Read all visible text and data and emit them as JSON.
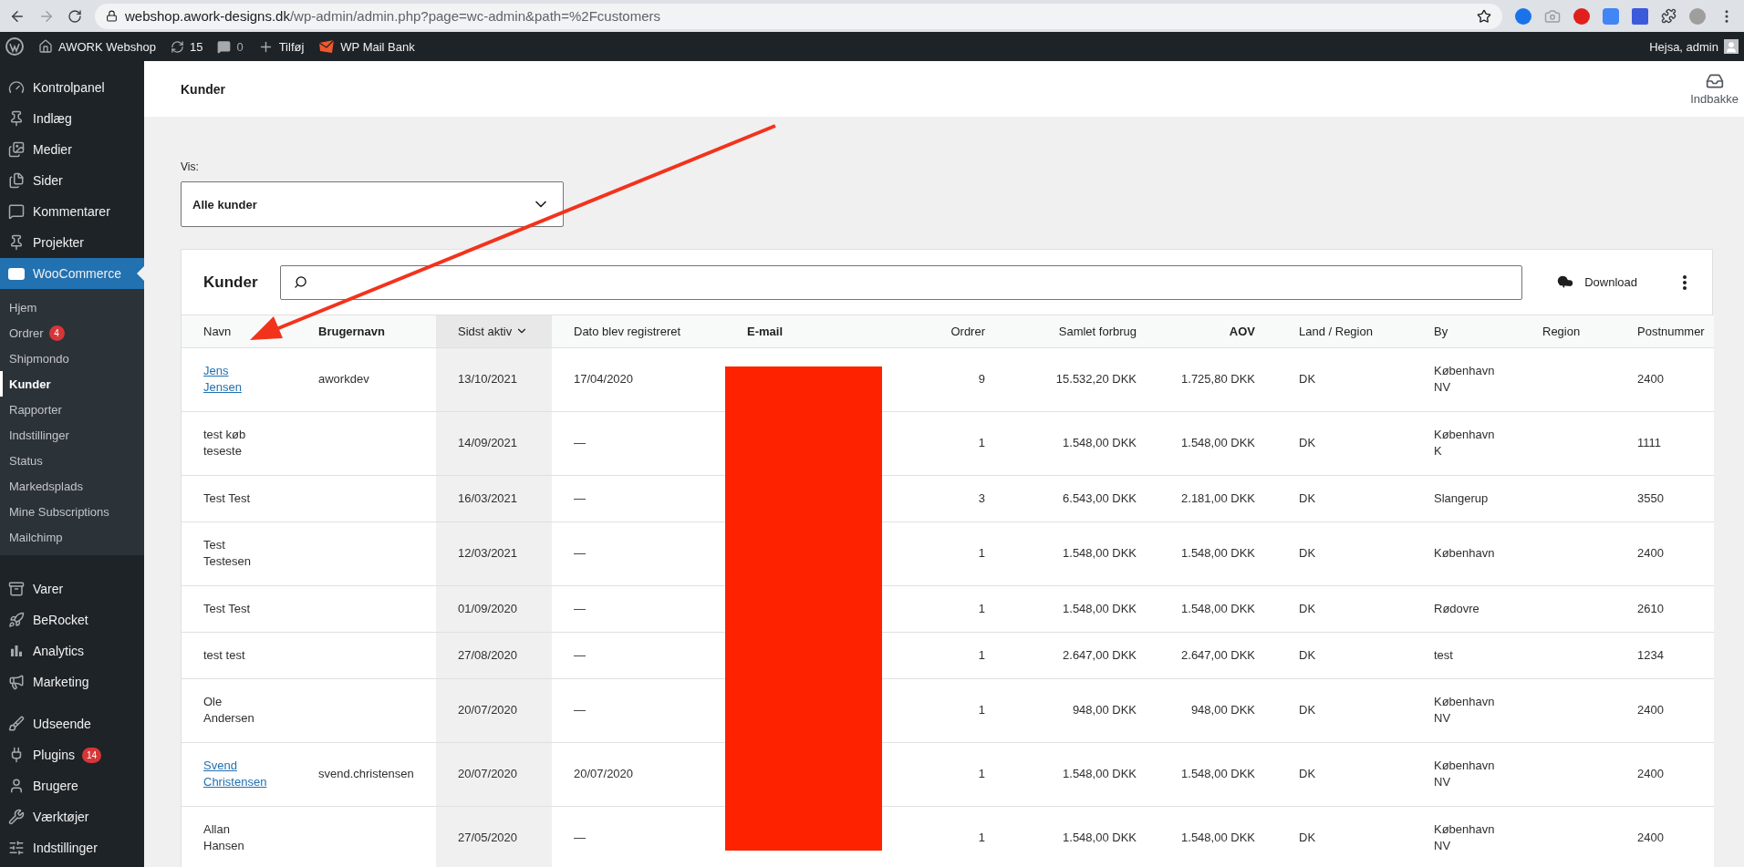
{
  "browser": {
    "url_host": "webshop.awork-designs.dk",
    "url_path": "/wp-admin/admin.php?page=wc-admin&path=%2Fcustomers"
  },
  "admin_bar": {
    "site_name": "AWORK Webshop",
    "updates": "15",
    "comments": "0",
    "new_label": "Tilføj",
    "plugin_label": "WP Mail Bank",
    "greeting": "Hejsa, admin"
  },
  "sidebar": {
    "items": [
      {
        "label": "Kontrolpanel",
        "selected": false
      },
      {
        "label": "Indlæg",
        "selected": false
      },
      {
        "label": "Medier",
        "selected": false
      },
      {
        "label": "Sider",
        "selected": false
      },
      {
        "label": "Kommentarer",
        "selected": false
      },
      {
        "label": "Projekter",
        "selected": false
      },
      {
        "label": "WooCommerce",
        "selected": true,
        "children": [
          {
            "label": "Hjem",
            "selected": false
          },
          {
            "label": "Ordrer",
            "selected": false,
            "badge": "4"
          },
          {
            "label": "Shipmondo",
            "selected": false
          },
          {
            "label": "Kunder",
            "selected": true
          },
          {
            "label": "Rapporter",
            "selected": false
          },
          {
            "label": "Indstillinger",
            "selected": false
          },
          {
            "label": "Status",
            "selected": false
          },
          {
            "label": "Markedsplads",
            "selected": false
          },
          {
            "label": "Mine Subscriptions",
            "selected": false
          },
          {
            "label": "Mailchimp",
            "selected": false
          }
        ]
      },
      {
        "label": "Varer",
        "selected": false
      },
      {
        "label": "BeRocket",
        "selected": false
      },
      {
        "label": "Analytics",
        "selected": false
      },
      {
        "label": "Marketing",
        "selected": false
      },
      {
        "label": "Udseende",
        "selected": false
      },
      {
        "label": "Plugins",
        "selected": false,
        "badge": "14"
      },
      {
        "label": "Brugere",
        "selected": false
      },
      {
        "label": "Værktøjer",
        "selected": false
      },
      {
        "label": "Indstillinger",
        "selected": false
      }
    ]
  },
  "header": {
    "title": "Kunder",
    "inbox_label": "Indbakke"
  },
  "filter": {
    "label": "Vis:",
    "value": "Alle kunder"
  },
  "card": {
    "title": "Kunder",
    "download_label": "Download"
  },
  "table": {
    "columns": [
      {
        "label": "Navn",
        "kind": "text",
        "bold": false,
        "sorted": false
      },
      {
        "label": "Brugernavn",
        "kind": "text",
        "bold": true,
        "sorted": false
      },
      {
        "label": "Sidst aktiv",
        "kind": "text",
        "bold": false,
        "sorted": true
      },
      {
        "label": "Dato blev registreret",
        "kind": "text",
        "bold": false,
        "sorted": false
      },
      {
        "label": "E-mail",
        "kind": "text",
        "bold": true,
        "sorted": false,
        "redacted": true
      },
      {
        "label": "Ordrer",
        "kind": "number",
        "bold": false,
        "sorted": false
      },
      {
        "label": "Samlet forbrug",
        "kind": "number",
        "bold": false,
        "sorted": false
      },
      {
        "label": "AOV",
        "kind": "number",
        "bold": true,
        "sorted": false
      },
      {
        "label": "Land / Region",
        "kind": "text",
        "bold": false,
        "sorted": false
      },
      {
        "label": "By",
        "kind": "text",
        "bold": false,
        "sorted": false
      },
      {
        "label": "Region",
        "kind": "text",
        "bold": false,
        "sorted": false
      },
      {
        "label": "Postnummer",
        "kind": "text",
        "bold": false,
        "sorted": false
      }
    ],
    "rows": [
      {
        "link": true,
        "name": "Jens Jensen",
        "username": "aworkdev",
        "last_active": "13/10/2021",
        "registered": "17/04/2020",
        "orders": "9",
        "total": "15.532,20 DKK",
        "aov": "1.725,80 DKK",
        "country": "DK",
        "city": "København NV",
        "postcode": "2400"
      },
      {
        "link": false,
        "name": "test køb teseste",
        "last_active": "14/09/2021",
        "registered": "—",
        "orders": "1",
        "total": "1.548,00 DKK",
        "aov": "1.548,00 DKK",
        "country": "DK",
        "city": "København K",
        "postcode": "1111"
      },
      {
        "link": false,
        "name": "Test Test",
        "last_active": "16/03/2021",
        "registered": "—",
        "orders": "3",
        "total": "6.543,00 DKK",
        "aov": "2.181,00 DKK",
        "country": "DK",
        "city": "Slangerup",
        "postcode": "3550"
      },
      {
        "link": false,
        "name": "Test Testesen",
        "last_active": "12/03/2021",
        "registered": "—",
        "orders": "1",
        "total": "1.548,00 DKK",
        "aov": "1.548,00 DKK",
        "country": "DK",
        "city": "København",
        "postcode": "2400"
      },
      {
        "link": false,
        "name": "Test Test",
        "last_active": "01/09/2020",
        "registered": "—",
        "orders": "1",
        "total": "1.548,00 DKK",
        "aov": "1.548,00 DKK",
        "country": "DK",
        "city": "Rødovre",
        "postcode": "2610"
      },
      {
        "link": false,
        "name": "test test",
        "last_active": "27/08/2020",
        "registered": "—",
        "orders": "1",
        "total": "2.647,00 DKK",
        "aov": "2.647,00 DKK",
        "country": "DK",
        "city": "test",
        "postcode": "1234"
      },
      {
        "link": false,
        "name": "Ole Andersen",
        "last_active": "20/07/2020",
        "registered": "—",
        "orders": "1",
        "total": "948,00 DKK",
        "aov": "948,00 DKK",
        "country": "DK",
        "city": "København NV",
        "postcode": "2400"
      },
      {
        "link": true,
        "name": "Svend Christensen",
        "username": "svend.christensen",
        "last_active": "20/07/2020",
        "registered": "20/07/2020",
        "orders": "1",
        "total": "1.548,00 DKK",
        "aov": "1.548,00 DKK",
        "country": "DK",
        "city": "København NV",
        "postcode": "2400"
      },
      {
        "link": false,
        "name": "Allan Hansen",
        "last_active": "27/05/2020",
        "registered": "—",
        "orders": "1",
        "total": "1.548,00 DKK",
        "aov": "1.548,00 DKK",
        "country": "DK",
        "city": "København NV",
        "postcode": "2400"
      }
    ]
  }
}
